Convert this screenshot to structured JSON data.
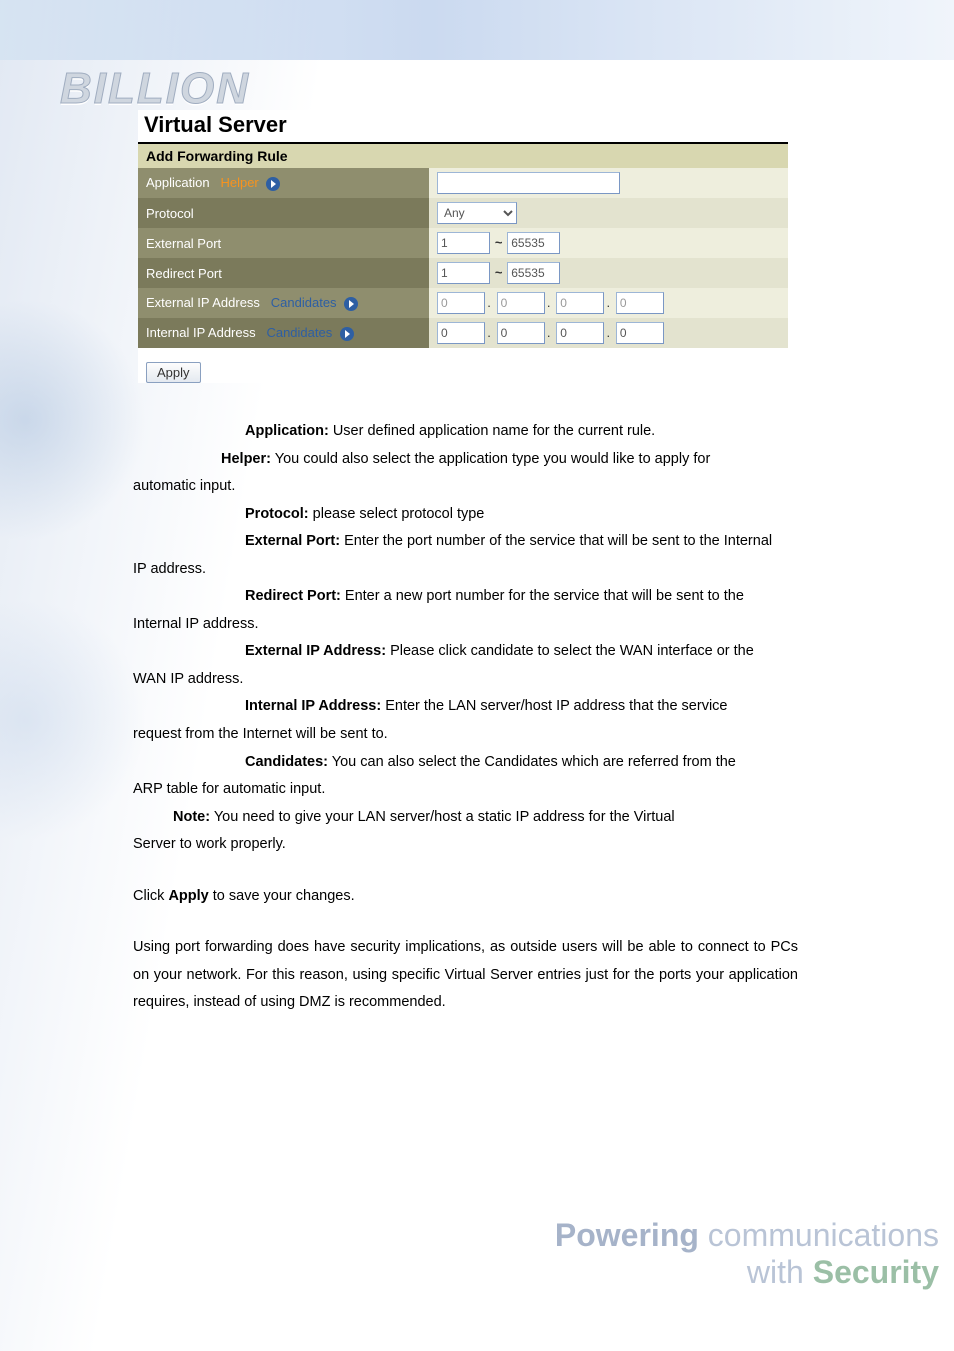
{
  "logo_text": "BILLION",
  "panel": {
    "title": "Virtual Server",
    "section_title": "Add Forwarding Rule",
    "rows": {
      "application": {
        "label": "Application",
        "helper": "Helper",
        "value": ""
      },
      "protocol": {
        "label": "Protocol",
        "selected": "Any"
      },
      "external_port": {
        "label": "External Port",
        "from": "1",
        "to": "65535"
      },
      "redirect_port": {
        "label": "Redirect Port",
        "from": "1",
        "to": "65535"
      },
      "external_ip": {
        "label": "External IP Address",
        "candidates": "Candidates",
        "octets": [
          "0",
          "0",
          "0",
          "0"
        ]
      },
      "internal_ip": {
        "label": "Internal IP Address",
        "candidates": "Candidates",
        "octets": [
          "0",
          "0",
          "0",
          "0"
        ]
      }
    },
    "apply": "Apply"
  },
  "body_text": {
    "application_desc": "User defined application name for the current rule.",
    "helper_desc_1": "You could also select the application type you would like to apply for",
    "helper_desc_2": "automatic input.",
    "protocol_desc": "please select protocol type",
    "external_port_desc_1": "Enter the port number of the service that will be sent to the Internal",
    "external_port_desc_2": "IP address.",
    "redirect_port_desc_1": "Enter a new port number for the service that will be sent to the",
    "redirect_port_desc_2": "Internal IP address.",
    "external_ip_desc_1": "Please click candidate to select the WAN interface or the",
    "external_ip_desc_2": "WAN IP address.",
    "internal_ip_desc_1": "Enter the LAN server/host IP address that the service",
    "internal_ip_desc_2": "request from the Internet will be sent to.",
    "candidates_desc_1": "You can also select the Candidates which are referred from the",
    "candidates_desc_2": "ARP table for automatic input.",
    "note_1": "You need to give your LAN server/host a static IP address for the Virtual",
    "note_2": "Server to work properly.",
    "apply_text_1": "Click ",
    "apply_text_2": " to save your changes.",
    "security_para": "Using port forwarding does have security implications, as outside users will be able to connect to PCs on your network. For this reason, using specific Virtual Server entries just for the ports your application requires, instead of using DMZ is recommended."
  },
  "terms": {
    "application": "Application:",
    "helper": "Helper:",
    "protocol": "Protocol:",
    "external_port": "External Port:",
    "redirect_port": "Redirect Port:",
    "external_ip": "External IP Address:",
    "internal_ip": "Internal IP Address:",
    "candidates": "Candidates:",
    "note": "Note:",
    "apply": "Apply"
  },
  "footer": {
    "line1a": "Powering",
    "line1b": "communications",
    "line2a": "with",
    "line2b": "Security"
  }
}
